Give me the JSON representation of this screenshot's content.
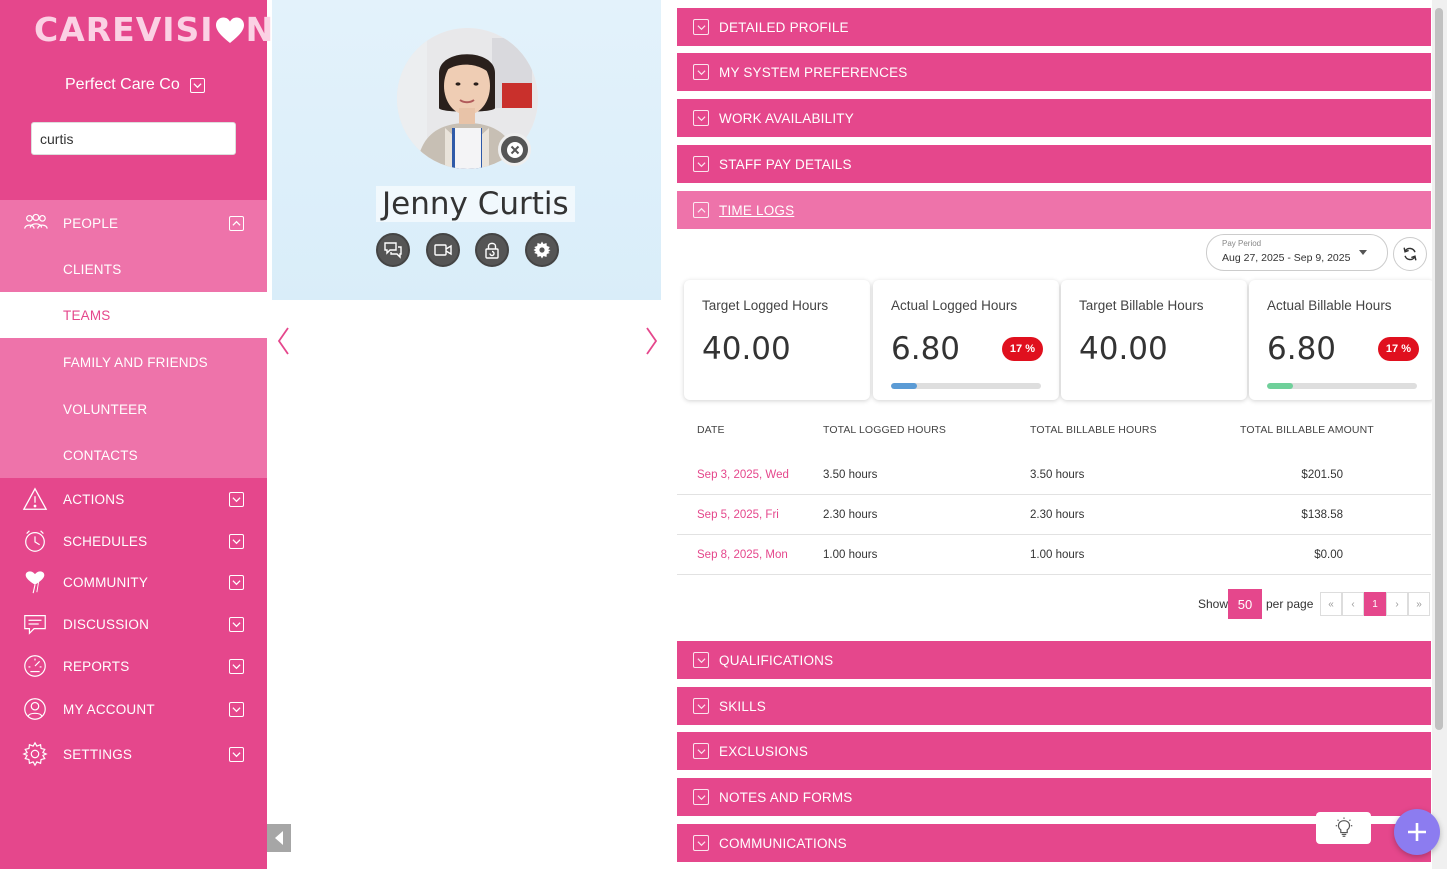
{
  "app": {
    "logo_text_left": "CAREVISI",
    "logo_text_right": "N",
    "organization": "Perfect Care Co",
    "search_value": "curtis"
  },
  "sidebar": {
    "people_label": "PEOPLE",
    "sub_items": [
      "CLIENTS",
      "TEAMS",
      "FAMILY AND FRIENDS",
      "VOLUNTEER",
      "CONTACTS"
    ],
    "active_sub_item": "TEAMS",
    "items": [
      "ACTIONS",
      "SCHEDULES",
      "COMMUNITY",
      "DISCUSSION",
      "REPORTS",
      "MY ACCOUNT",
      "SETTINGS"
    ]
  },
  "profile": {
    "name": "Jenny Curtis"
  },
  "sections_top": [
    "DETAILED PROFILE",
    "MY SYSTEM PREFERENCES",
    "WORK AVAILABILITY",
    "STAFF PAY DETAILS"
  ],
  "time_logs": {
    "title": "TIME LOGS",
    "pay_period_label": "Pay Period",
    "pay_period_value": "Aug 27, 2025 - Sep 9, 2025",
    "cards": [
      {
        "title": "Target Logged Hours",
        "value": "40.00"
      },
      {
        "title": "Actual Logged Hours",
        "value": "6.80",
        "badge": "17 %",
        "progress": 0.17,
        "bar_color": "#5b9bd5"
      },
      {
        "title": "Target Billable Hours",
        "value": "40.00"
      },
      {
        "title": "Actual Billable Hours",
        "value": "6.80",
        "badge": "17 %",
        "progress": 0.17,
        "bar_color": "#6fd09a"
      }
    ],
    "columns": [
      "DATE",
      "TOTAL LOGGED HOURS",
      "TOTAL BILLABLE HOURS",
      "TOTAL BILLABLE AMOUNT"
    ],
    "rows": [
      {
        "date": "Sep 3, 2025, Wed",
        "logged": "3.50 hours",
        "billable": "3.50 hours",
        "amount": "$201.50"
      },
      {
        "date": "Sep 5, 2025, Fri",
        "logged": "2.30 hours",
        "billable": "2.30 hours",
        "amount": "$138.58"
      },
      {
        "date": "Sep 8, 2025, Mon",
        "logged": "1.00 hours",
        "billable": "1.00 hours",
        "amount": "$0.00"
      }
    ],
    "pagination": {
      "show_label": "Show",
      "page_size": "50",
      "per_page_label": "per page",
      "first": "«",
      "prev": "‹",
      "current": "1",
      "next": "›",
      "last": "»"
    }
  },
  "sections_bottom": [
    "QUALIFICATIONS",
    "SKILLS",
    "EXCLUSIONS",
    "NOTES AND FORMS",
    "COMMUNICATIONS"
  ],
  "colors": {
    "brand_pink": "#e5478c",
    "light_pink": "#ee73aa",
    "badge_red": "#e0101e",
    "fab_purple": "#8c7cf0"
  },
  "icons": {
    "people": "people-icon",
    "actions": "warning-icon",
    "schedules": "clock-icon",
    "community": "heart-balloon-icon",
    "discussion": "chat-icon",
    "reports": "gauge-icon",
    "my_account": "user-icon",
    "settings": "gear-icon"
  }
}
